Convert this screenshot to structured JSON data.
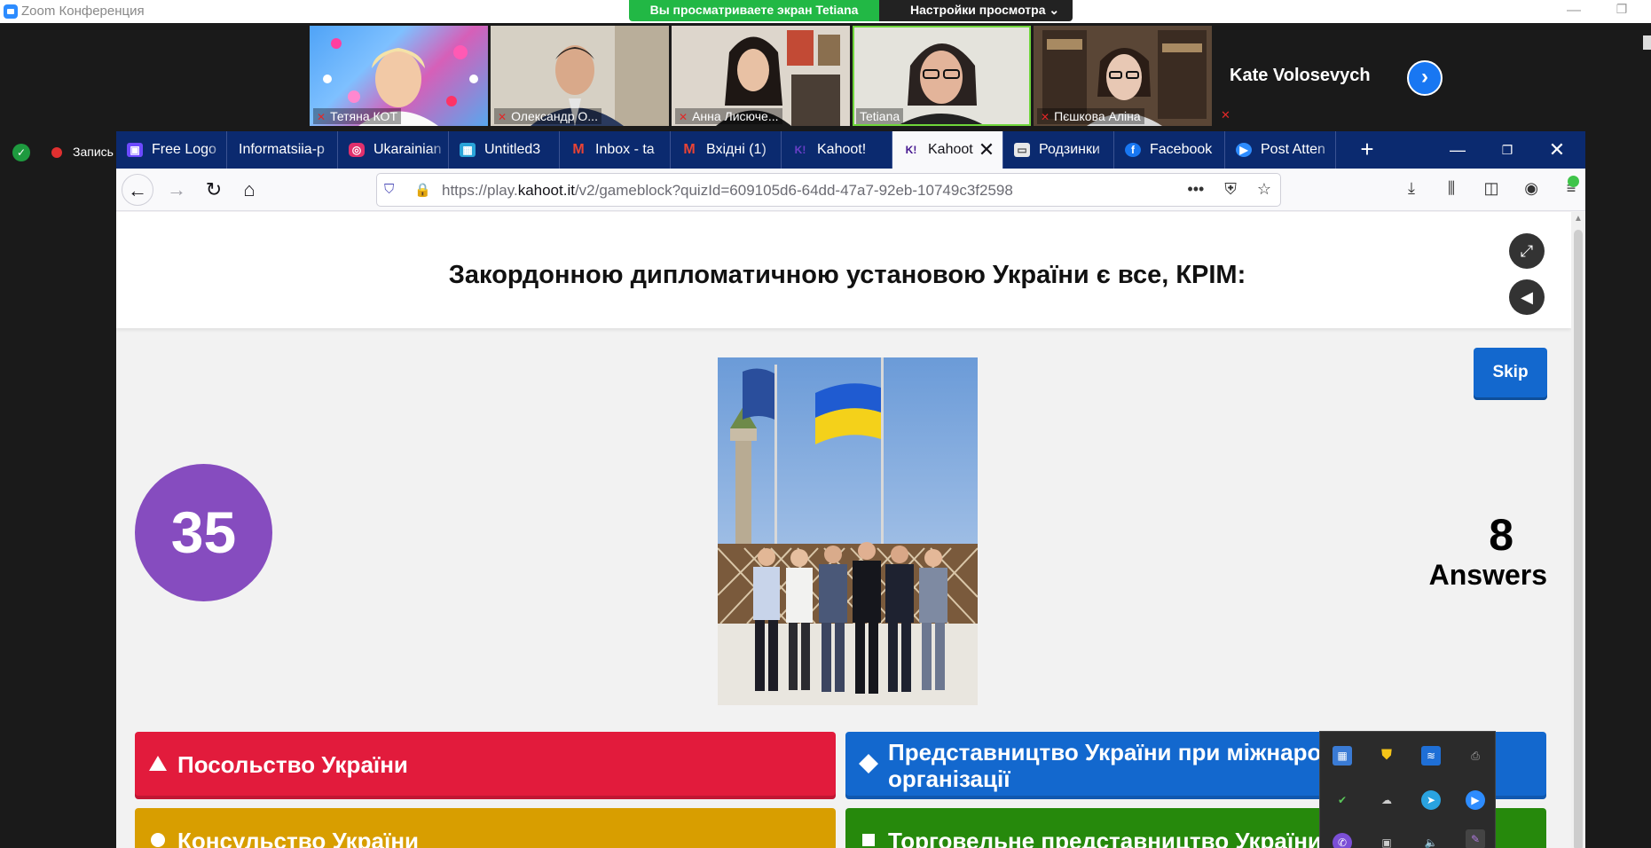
{
  "zoom": {
    "window_title": "Zoom Конференция",
    "share_banner": "Вы просматриваете экран Tetiana",
    "view_settings": "Настройки просмотра ⌄",
    "record_label": "Запись",
    "participants": [
      {
        "name": "Тетяна КОТ"
      },
      {
        "name": "Олександр О..."
      },
      {
        "name": "Анна Лисюче..."
      },
      {
        "name": "Tetiana"
      },
      {
        "name": "Пєшкова Аліна"
      }
    ],
    "extra_participant": "Kate Volosevych",
    "active_speaker_color": "#6fd63a"
  },
  "browser": {
    "tabs": [
      {
        "label": "Free Logo",
        "icon": "canva-icon",
        "color": "#6d4aff"
      },
      {
        "label": "Informatsiia-p",
        "icon": "",
        "color": ""
      },
      {
        "label": "Ukarainian",
        "icon": "instagram-icon",
        "color": "#e1306c"
      },
      {
        "label": "Untitled3",
        "icon": "grid-icon",
        "color": "#2aa4d8"
      },
      {
        "label": "Inbox - ta",
        "icon": "gmail-icon",
        "color": "#d93025"
      },
      {
        "label": "Вхідні (1)",
        "icon": "gmail-icon",
        "color": "#d93025"
      },
      {
        "label": "Kahoot!",
        "icon": "kahoot-icon",
        "color": "#46178f"
      },
      {
        "label": "Kahoot",
        "icon": "kahoot-icon",
        "color": "#46178f"
      },
      {
        "label": "Родзинки",
        "icon": "slides-icon",
        "color": "#999"
      },
      {
        "label": "Facebook",
        "icon": "facebook-icon",
        "color": "#1877f2"
      },
      {
        "label": "Post Atten",
        "icon": "zoom-icon",
        "color": "#2d8cff"
      }
    ],
    "url_prefix": "https://play.",
    "url_host": "kahoot.it",
    "url_path": "/v2/gameblock?quizId=609105d6-64dd-47a7-92eb-10749c3f2598"
  },
  "kahoot": {
    "question": "Закордонною дипломатичною установою України є все, КРІМ:",
    "skip_label": "Skip",
    "timer": "35",
    "answers_count": "8",
    "answers_label": "Answers",
    "options": [
      {
        "text": "Посольство України",
        "color": "#e21b3c",
        "shape": "triangle"
      },
      {
        "text": "Представництво України при міжнародній організації",
        "color": "#1368ce",
        "shape": "diamond"
      },
      {
        "text": "Консульство України",
        "color": "#d89e00",
        "shape": "circle"
      },
      {
        "text": "Торговельне представництво України за кордоном",
        "color": "#26890c",
        "shape": "square"
      }
    ]
  }
}
